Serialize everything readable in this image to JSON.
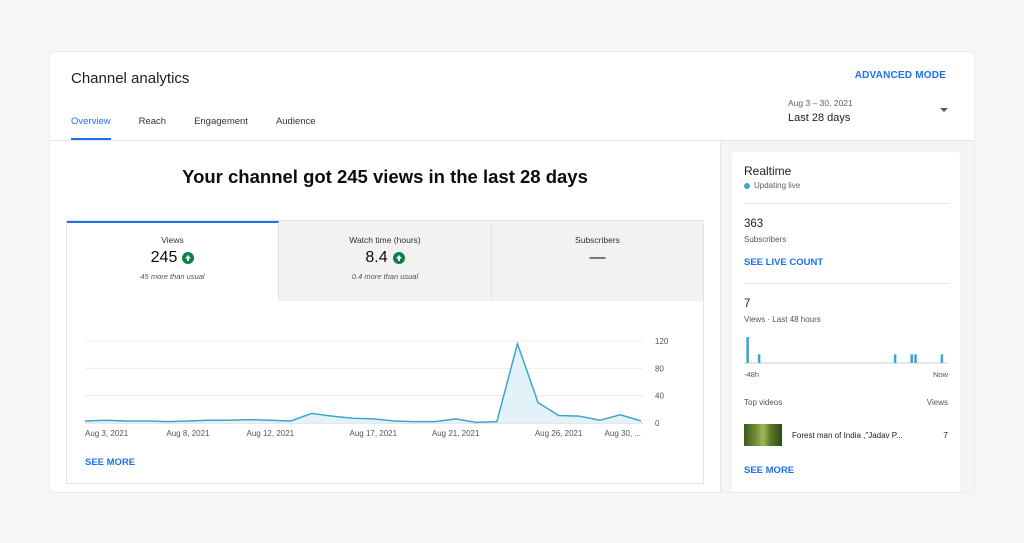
{
  "header": {
    "title": "Channel analytics",
    "advanced_mode": "ADVANCED MODE",
    "tabs": [
      {
        "label": "Overview",
        "active": true
      },
      {
        "label": "Reach",
        "active": false
      },
      {
        "label": "Engagement",
        "active": false
      },
      {
        "label": "Audience",
        "active": false
      }
    ],
    "date_range": "Aug 3 – 30, 2021",
    "date_label": "Last 28 days"
  },
  "main": {
    "headline": "Your channel got 245 views in the last 28 days",
    "metrics": [
      {
        "label": "Views",
        "value": "245",
        "note": "45 more than usual",
        "trend": "up",
        "active": true
      },
      {
        "label": "Watch time (hours)",
        "value": "8.4",
        "note": "0.4 more than usual",
        "trend": "up",
        "active": false
      },
      {
        "label": "Subscribers",
        "value": "—",
        "note": "",
        "trend": "none",
        "active": false
      }
    ],
    "see_more": "SEE MORE"
  },
  "chart_data": {
    "type": "area",
    "series": [
      {
        "values": [
          3,
          4,
          3,
          3,
          2,
          3,
          4,
          4,
          5,
          4,
          3,
          14,
          10,
          7,
          6,
          3,
          2,
          2,
          6,
          1,
          2,
          116,
          30,
          11,
          10,
          4,
          12,
          3
        ]
      }
    ],
    "x_tick_labels": [
      "Aug 3, 2021",
      "Aug 8, 2021",
      "Aug 12, 2021",
      "Aug 17, 2021",
      "Aug 21, 2021",
      "Aug 26, 2021",
      "Aug 30, ..."
    ],
    "y_ticks": [
      0,
      40,
      80,
      120
    ],
    "ylim": [
      0,
      120
    ],
    "grid": true,
    "line_color": "#3ea6c8",
    "fill_color": "#e3f1f8"
  },
  "realtime": {
    "title": "Realtime",
    "status": "Updating live",
    "subscribers_count": "363",
    "subscribers_label": "Subscribers",
    "live_count_link": "SEE LIVE COUNT",
    "views_count": "7",
    "views_label": "Views · Last 48 hours",
    "axis_start": "-48h",
    "axis_end": "Now",
    "bars": [
      {
        "hours_ago": 47.2,
        "value": 3
      },
      {
        "hours_ago": 44.5,
        "value": 1
      },
      {
        "hours_ago": 12.5,
        "value": 1
      },
      {
        "hours_ago": 8.6,
        "value": 1
      },
      {
        "hours_ago": 7.7,
        "value": 1
      },
      {
        "hours_ago": 1.5,
        "value": 1
      }
    ],
    "top_videos_label": "Top videos",
    "views_col_label": "Views",
    "top_video": {
      "title": "Forest man of India ,\"Jadav P...",
      "views": "7"
    },
    "see_more": "SEE MORE",
    "bar_color": "#3ea6c8"
  }
}
